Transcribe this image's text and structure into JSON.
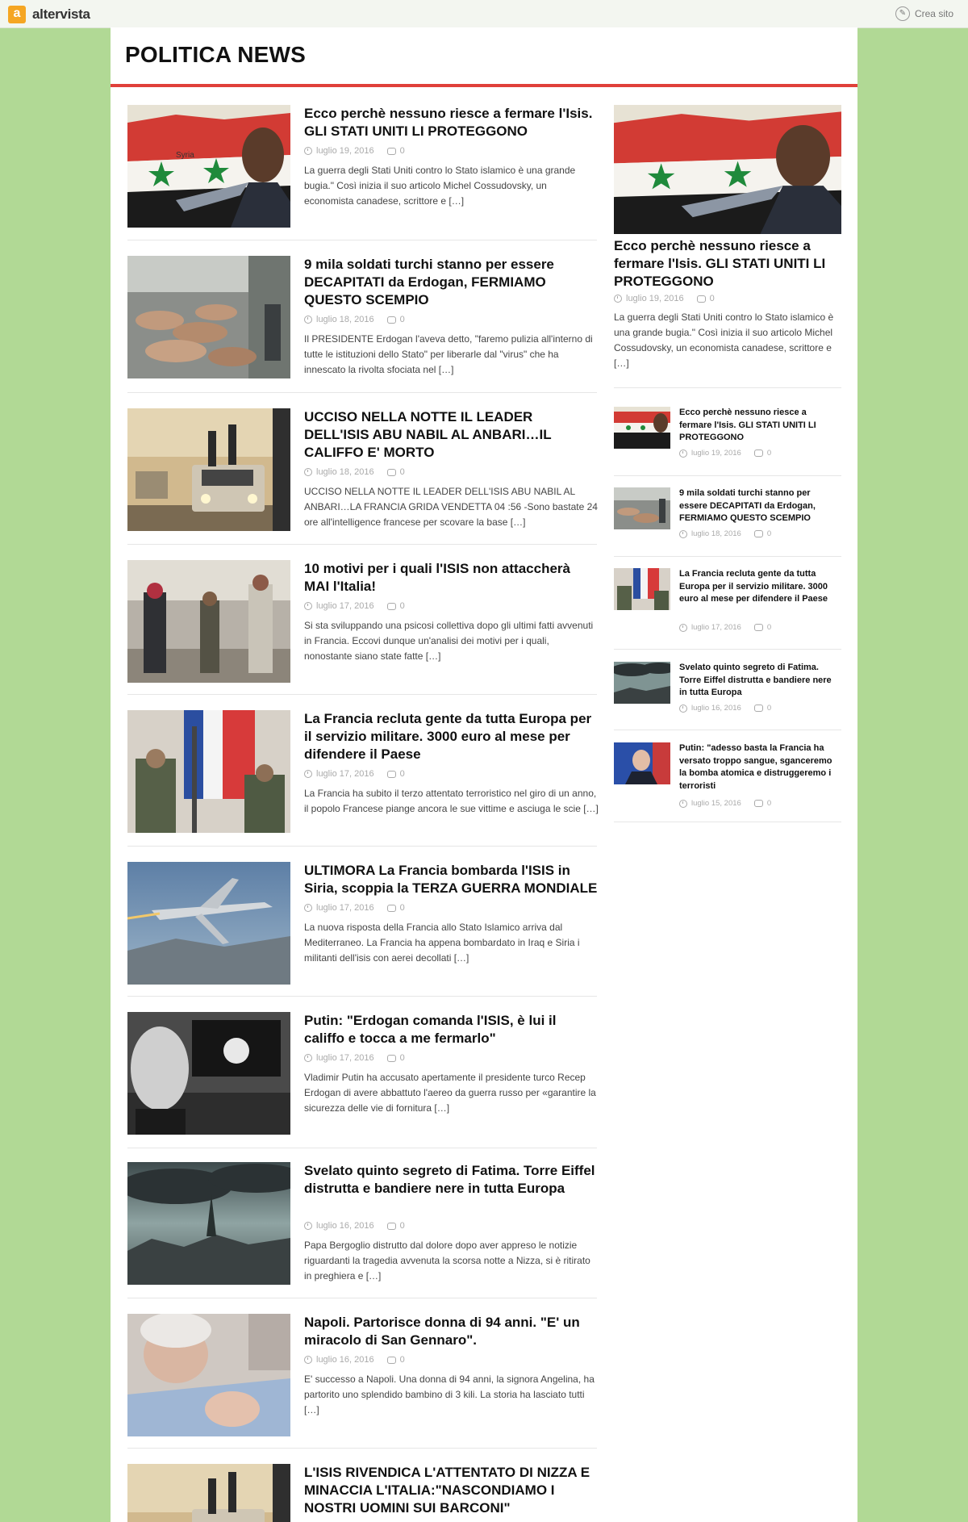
{
  "topbar": {
    "brand_letter": "a",
    "brand_name": "altervista",
    "create_site": "Crea sito"
  },
  "site": {
    "title": "POLITICA NEWS"
  },
  "posts": [
    {
      "title": "Ecco perchè nessuno riesce a fermare l'Isis. GLI STATI UNITI LI PROTEGGONO",
      "date": "luglio 19, 2016",
      "comments": "0",
      "excerpt": "La guerra degli Stati Uniti contro lo Stato islamico è una grande bugia.\" Così inizia il suo articolo Michel Cossudovsky, un economista canadese, scrittore e […]",
      "image": "syria-flag-obama"
    },
    {
      "title": "9 mila soldati turchi stanno per essere DECAPITATI da Erdogan, FERMIAMO QUESTO SCEMPIO",
      "date": "luglio 18, 2016",
      "comments": "0",
      "excerpt": "Il PRESIDENTE Erdogan l'aveva detto, \"faremo pulizia all'interno di tutte le istituzioni dello Stato\" per liberarle dal \"virus\" che ha innescato la rivolta sfociata nel […]",
      "image": "detained-soldiers"
    },
    {
      "title": "UCCISO NELLA NOTTE IL LEADER DELL'ISIS ABU NABIL AL ANBARI…IL CALIFFO E' MORTO",
      "date": "luglio 18, 2016",
      "comments": "0",
      "excerpt": "UCCISO NELLA NOTTE IL LEADER DELL'ISIS ABU NABIL AL ANBARI…LA FRANCIA GRIDA VENDETTA 04 :56 -Sono bastate 24 ore  all'intelligence francese per scovare la base […]",
      "image": "militant-convoy"
    },
    {
      "title": "10 motivi per i quali l'ISIS non attaccherà MAI l'Italia!",
      "date": "luglio 17, 2016",
      "comments": "0",
      "excerpt": "Si sta sviluppando una psicosi collettiva dopo gli ultimi fatti avvenuti in Francia. Eccovi dunque un'analisi dei motivi per i quali, nonostante siano state fatte […]",
      "image": "militants-street"
    },
    {
      "title": "La Francia recluta gente da tutta Europa per il servizio militare. 3000 euro al mese per difendere il Paese",
      "date": "luglio 17, 2016",
      "comments": "0",
      "excerpt": "La Francia ha subito il terzo attentato terroristico nel giro di un anno, il popolo Francese piange ancora le sue vittime e asciuga le scie […]",
      "image": "french-soldiers-flag"
    },
    {
      "title": "ULTIMORA La Francia bombarda l'ISIS in Siria, scoppia la TERZA GUERRA MONDIALE",
      "date": "luglio 17, 2016",
      "comments": "0",
      "excerpt": "La nuova risposta della Francia allo Stato Islamico arriva dal Mediterraneo. La Francia ha appena bombardato in  Iraq e Siria i militanti dell'isis con aerei decollati […]",
      "image": "fighter-jet"
    },
    {
      "title": "Putin: \"Erdogan comanda l'ISIS, è lui il califfo e tocca a me fermarlo\"",
      "date": "luglio 17, 2016",
      "comments": "0",
      "excerpt": "Vladimir Putin ha accusato apertamente il presidente turco Recep Erdogan di avere abbattuto l'aereo da guerra russo per «garantire la sicurezza delle vie di fornitura […]",
      "image": "erdogan-isis-flag"
    },
    {
      "title": "Svelato quinto segreto di Fatima. Torre Eiffel distrutta e bandiere nere in tutta Europa",
      "date": "luglio 16, 2016",
      "comments": "0",
      "excerpt": "Papa Bergoglio distrutto dal dolore dopo aver appreso le notizie riguardanti la tragedia avvenuta la scorsa notte a Nizza, si è ritirato in preghiera e […]",
      "image": "destroyed-city"
    },
    {
      "title": "Napoli. Partorisce donna di 94 anni. \"E' un miracolo di San Gennaro\".",
      "date": "luglio 16, 2016",
      "comments": "0",
      "excerpt": "E' successo a Napoli. Una donna di 94 anni, la signora Angelina, ha partorito uno splendido bambino di 3 kili. La storia ha lasciato tutti […]",
      "image": "elderly-woman-baby"
    },
    {
      "title": "L'ISIS RIVENDICA L'ATTENTATO DI NIZZA E MINACCIA L'ITALIA:\"NASCONDIAMO I NOSTRI UOMINI SUI BARCONI\"",
      "date": "",
      "comments": "",
      "excerpt": "",
      "image": "militant-convoy"
    }
  ],
  "sidebar": {
    "feature": {
      "title": "Ecco perchè nessuno riesce a fermare l'Isis. GLI STATI UNITI LI PROTEGGONO",
      "date": "luglio 19, 2016",
      "comments": "0",
      "excerpt": "La guerra degli Stati Uniti contro lo Stato islamico è una grande bugia.\" Così inizia il suo articolo Michel Cossudovsky, un economista canadese, scrittore e […]",
      "image": "syria-flag-obama"
    },
    "items": [
      {
        "title": "Ecco perchè nessuno riesce a fermare l'Isis. GLI STATI UNITI LI PROTEGGONO",
        "date": "luglio 19, 2016",
        "comments": "0",
        "image": "syria-flag-obama"
      },
      {
        "title": "9 mila soldati turchi stanno per essere DECAPITATI da Erdogan, FERMIAMO QUESTO SCEMPIO",
        "date": "luglio 18, 2016",
        "comments": "0",
        "image": "detained-soldiers"
      },
      {
        "title": "La Francia recluta gente da tutta Europa per il servizio militare. 3000 euro al mese per difendere il Paese",
        "date": "luglio 17, 2016",
        "comments": "0",
        "image": "french-soldiers-flag"
      },
      {
        "title": "Svelato quinto segreto di Fatima. Torre Eiffel distrutta e bandiere nere in tutta Europa",
        "date": "luglio 16, 2016",
        "comments": "0",
        "image": "destroyed-city"
      },
      {
        "title": "Putin: \"adesso basta la Francia ha versato troppo sangue, sganceremo la bomba atomica e distruggeremo i terroristi",
        "date": "luglio 15, 2016",
        "comments": "0",
        "image": "putin-portrait"
      }
    ]
  },
  "colors": {
    "background": "#b1d995",
    "accent": "#e0403a",
    "brand": "#f5a623"
  }
}
